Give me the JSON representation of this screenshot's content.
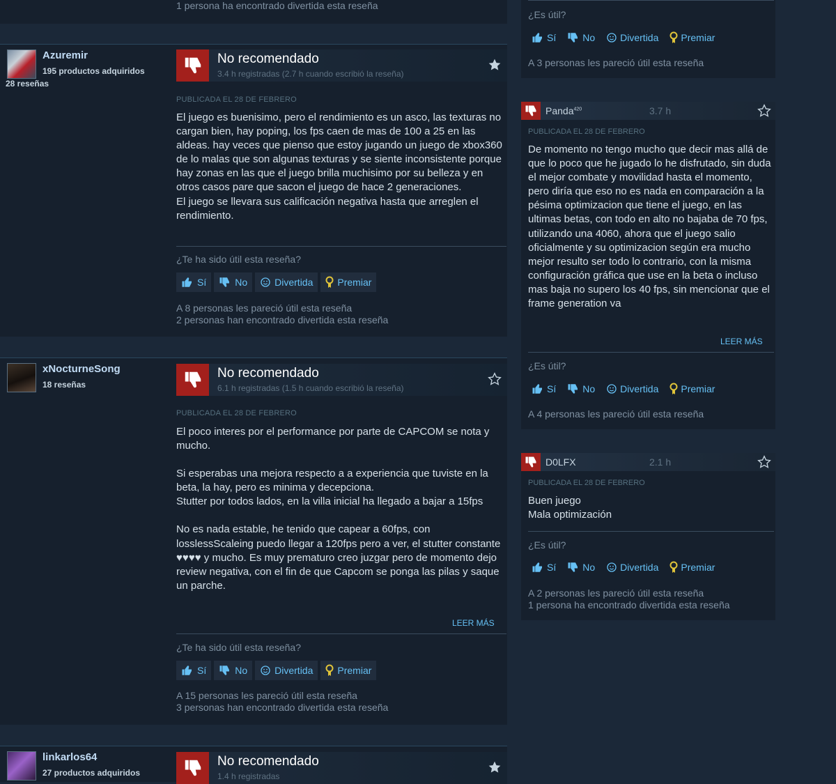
{
  "top_stub": {
    "funny": "1 persona ha encontrado divertida esta reseña"
  },
  "left_reviews": [
    {
      "author": "Azuremir",
      "meta1": "195 productos adquiridos",
      "meta2": "28 reseñas",
      "verdict": "No recomendado",
      "hours": "3.4 h registradas (2.7 h cuando escribió la reseña)",
      "posted": "PUBLICADA EL 28 DE FEBRERO",
      "paragraphs": [
        "El juego es buenisimo, pero el rendimiento es un asco, las texturas no cargan bien, hay poping, los fps caen de mas de 100 a 25 en las aldeas. hay veces que pienso que estoy jugando un juego de xbox360 de lo malas que son algunas texturas y se siente inconsistente porque hay zonas en las que el juego brilla muchisimo por su belleza y en otros casos pare que sacon el juego de hace 2 generaciones.",
        "El juego se llevara sus calificación negativa hasta que arreglen el rendimiento."
      ],
      "question": "¿Te ha sido útil esta reseña?",
      "stat_helpful": "A 8 personas les pareció útil esta reseña",
      "stat_funny": "2 personas han encontrado divertida esta reseña"
    },
    {
      "author": "xNocturneSong",
      "meta1": "18 reseñas",
      "verdict": "No recomendado",
      "hours": "6.1 h registradas (1.5 h cuando escribió la reseña)",
      "posted": "PUBLICADA EL 28 DE FEBRERO",
      "p1": "El poco interes por el performance por parte de CAPCOM se nota y mucho.",
      "p2a": "Si esperabas una mejora respecto a a experiencia que tuviste en la beta, la hay, pero es minima y decepciona.",
      "p2b": "Stutter por todos lados, en la villa inicial ha llegado a bajar a 15fps",
      "p3": "No es nada estable, he tenido que capear a 60fps, con losslessScaleing puedo llegar a 120fps pero a ver, el stutter constante ♥♥♥♥ y mucho. Es muy prematuro creo juzgar pero de momento dejo review negativa, con el fin de que Capcom se ponga las pilas y saque un parche.",
      "read_more": "LEER MÁS",
      "question": "¿Te ha sido útil esta reseña?",
      "stat_helpful": "A 15 personas les pareció útil esta reseña",
      "stat_funny": "3 personas han encontrado divertida esta reseña"
    },
    {
      "author": "linkarlos64",
      "meta1": "27 productos adquiridos",
      "verdict": "No recomendado",
      "hours": "1.4 h registradas"
    }
  ],
  "buttons": {
    "yes": "Sí",
    "no": "No",
    "funny": "Divertida",
    "award": "Premiar"
  },
  "right_top": {
    "question": "¿Es útil?",
    "stat_helpful": "A 3 personas les pareció útil esta reseña"
  },
  "right_reviews": [
    {
      "author": "Panda",
      "author_sup": "420",
      "hours": "3.7 h",
      "posted": "PUBLICADA EL 28 DE FEBRERO",
      "text": "De momento no tengo mucho que decir mas allá de que lo poco que he jugado lo he disfrutado, sin duda el mejor combate y movilidad hasta el momento, pero diría que eso no es nada en comparación a la pésima optimizacion que tiene el juego, en las ultimas betas, con todo en alto no bajaba de 70 fps, utilizando una 4060, ahora que el juego salio oficialmente y su optimizacion según era mucho mejor resulto ser todo lo contrario, con la misma configuración gráfica que use en la beta o incluso mas baja no supero los 40 fps, sin mencionar que el frame generation va",
      "read_more": "LEER MÁS",
      "question": "¿Es útil?",
      "stat_helpful": "A 4 personas les pareció útil esta reseña"
    },
    {
      "author": "D0LFX",
      "hours": "2.1 h",
      "posted": "PUBLICADA EL 28 DE FEBRERO",
      "line1": "Buen juego",
      "line2": "Mala optimización",
      "question": "¿Es útil?",
      "stat_helpful": "A 2 personas les pareció útil esta reseña",
      "stat_funny": "1 persona ha encontrado divertida esta reseña"
    }
  ],
  "colors": {
    "background": "#1b2838",
    "card": "#16202d",
    "thumb_down": "#a3201c",
    "link": "#66c0f4",
    "award": "#e0c43a"
  }
}
